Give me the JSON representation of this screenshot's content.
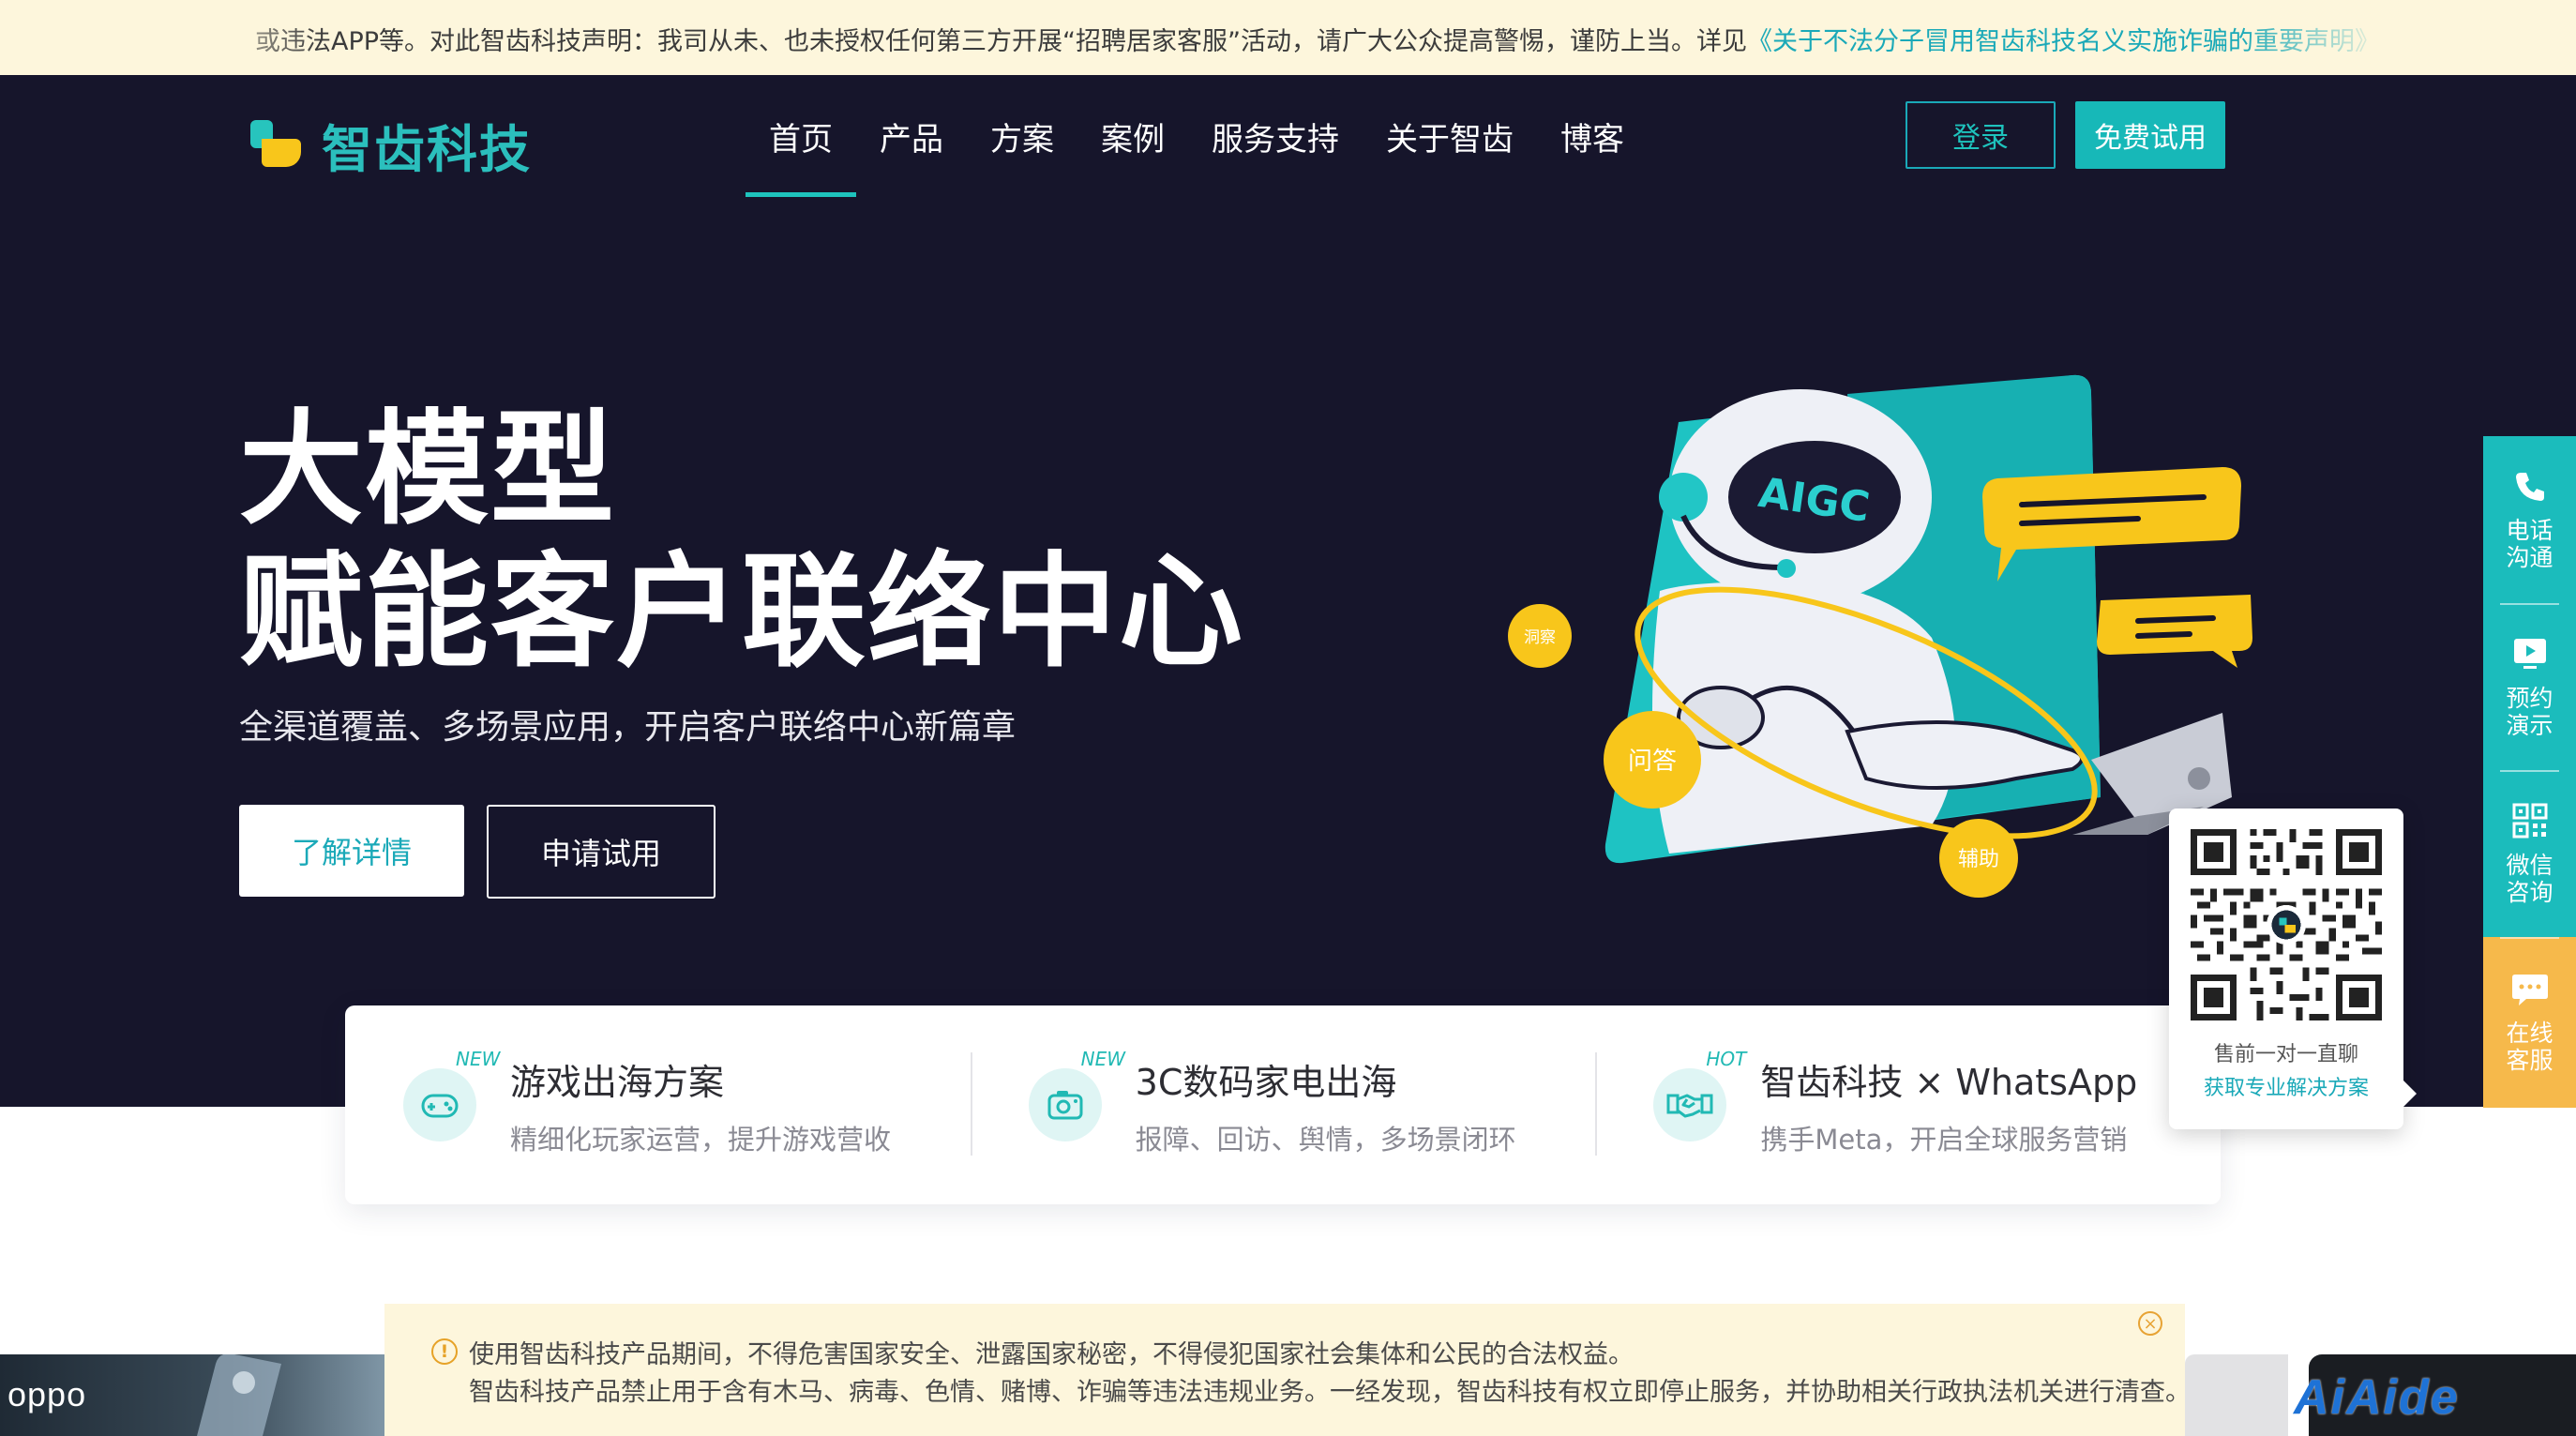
{
  "notice": {
    "text": "或违法APP等。对此智齿科技声明：我司从未、也未授权任何第三方开展“招聘居家客服”活动，请广大公众提高警惕，谨防上当。详见",
    "link": "《关于不法分子冒用智齿科技名义实施诈骗的重要声明》"
  },
  "header": {
    "logo_text": "智齿科技",
    "nav": [
      {
        "label": "首页",
        "active": true
      },
      {
        "label": "产品"
      },
      {
        "label": "方案"
      },
      {
        "label": "案例"
      },
      {
        "label": "服务支持"
      },
      {
        "label": "关于智齿"
      },
      {
        "label": "博客"
      }
    ],
    "login_label": "登录",
    "trial_label": "免费试用"
  },
  "hero": {
    "title_line1": "大模型",
    "title_line2": "赋能客户联络中心",
    "subtitle": "全渠道覆盖、多场景应用，开启客户联络中心新篇章",
    "detail_label": "了解详情",
    "apply_label": "申请试用",
    "illustration": {
      "badge": "AIGC",
      "orbit_labels": [
        "洞察",
        "问答",
        "辅助"
      ]
    }
  },
  "features": [
    {
      "badge": "NEW",
      "title": "游戏出海方案",
      "desc": "精细化玩家运营，提升游戏营收",
      "icon": "gamepad-icon"
    },
    {
      "badge": "NEW",
      "title": "3C数码家电出海",
      "desc": "报障、回访、舆情，多场景闭环",
      "icon": "camera-icon"
    },
    {
      "badge": "HOT",
      "title": "智齿科技 × WhatsApp",
      "desc": "携手Meta，开启全球服务营销",
      "icon": "handshake-icon"
    }
  ],
  "sidebar": [
    {
      "label": "电话沟通",
      "icon": "phone-icon"
    },
    {
      "label": "预约演示",
      "icon": "monitor-play-icon"
    },
    {
      "label": "微信咨询",
      "icon": "qrcode-icon"
    },
    {
      "label": "在线客服",
      "icon": "chat-bubble-icon"
    }
  ],
  "qr_popup": {
    "line1": "售前一对一直聊",
    "line2": "获取专业解决方案"
  },
  "warning": {
    "line1": "使用智齿科技产品期间，不得危害国家安全、泄露国家秘密，不得侵犯国家社会集体和公民的合法权益。",
    "line2": "智齿科技产品禁止用于含有木马、病毒、色情、赌博、诈骗等违法违规业务。一经发现，智齿科技有权立即停止服务，并协助相关行政执法机关进行清查。"
  },
  "logos": {
    "oppo": "oppo",
    "watermark": "AiAide"
  },
  "colors": {
    "teal": "#1bbcbc",
    "dark_bg": "#16152b",
    "yellow": "#f8c61b",
    "notice_bg": "#fdf6dc"
  }
}
